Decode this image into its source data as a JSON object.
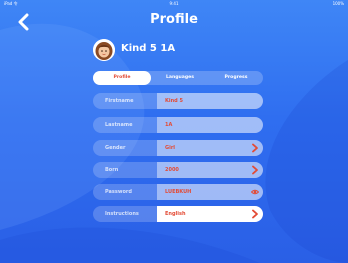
{
  "status_bar": {
    "left": "iPad 令",
    "time": "9:41",
    "battery": "100%"
  },
  "header": {
    "title": "Profile",
    "back_icon": "chevron-left-icon"
  },
  "user": {
    "name": "Kind 5 1A",
    "avatar_icon": "avatar-girl-icon"
  },
  "tabs": [
    {
      "label": "Profile",
      "active": true
    },
    {
      "label": "Languages",
      "active": false
    },
    {
      "label": "Progress",
      "active": false
    }
  ],
  "fields": [
    {
      "label": "Firstname",
      "value": "Kind 5",
      "control": ""
    },
    {
      "label": "Lastname",
      "value": "1A",
      "control": ""
    },
    {
      "label": "Gender",
      "value": "Girl",
      "control": "chevron-right-icon"
    },
    {
      "label": "Born",
      "value": "2000",
      "control": "chevron-right-icon"
    },
    {
      "label": "Password",
      "value": "LUEBKUH",
      "control": "eye-icon"
    },
    {
      "label": "Instructions",
      "value": "English",
      "control": "chevron-right-icon"
    }
  ],
  "colors": {
    "background": "#2f6ef0",
    "accent": "#e34b35",
    "text_light": "#ffffff"
  }
}
